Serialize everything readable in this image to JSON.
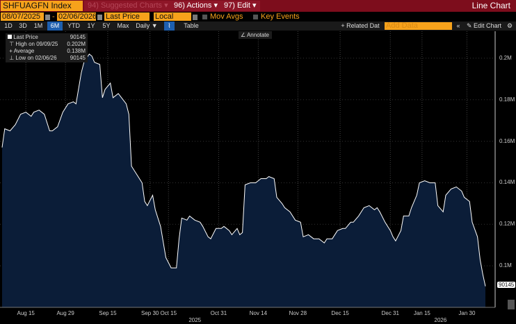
{
  "header": {
    "ticker": "SHFUAGFN Index",
    "menus": [
      {
        "label": "94) Suggested Charts ▾",
        "dim": true
      },
      {
        "label": "96) Actions ▾"
      },
      {
        "label": "97) Edit ▾"
      }
    ],
    "view": "Line Chart"
  },
  "controls": {
    "start_date": "08/07/2025",
    "end_date": "02/06/2026",
    "field": "Last Price",
    "currency": "Local CCY",
    "mov_avgs": "Mov Avgs",
    "key_events": "Key Events"
  },
  "toolbar": {
    "ranges": [
      "1D",
      "3D",
      "1M",
      "6M",
      "YTD",
      "1Y",
      "5Y",
      "Max"
    ],
    "active_range": "6M",
    "frequency": "Daily ▼",
    "table": "Table",
    "related": "+ Related Dat",
    "add_data_placeholder": "Add Data",
    "edit_chart": "Edit Chart",
    "annotate": "Annotate"
  },
  "legend": {
    "rows": [
      {
        "label": "Last Price",
        "value": "90145"
      },
      {
        "label": "High on 09/09/25",
        "value": "0.202M"
      },
      {
        "label": "Average",
        "value": "0.138M"
      },
      {
        "label": "Low on 02/06/26",
        "value": "90145"
      }
    ]
  },
  "colors": {
    "bar": "#7d0d1c",
    "accent": "#f7a21b",
    "fill": "#0b1d38",
    "line": "#ffffff"
  },
  "chart_data": {
    "type": "area",
    "title": "SHFUAGFN Index",
    "units": "thousands",
    "ylim": [
      80,
      213
    ],
    "xlim": [
      0,
      186
    ],
    "y_ticks": [
      {
        "v": 100,
        "label": "0.1M"
      },
      {
        "v": 120,
        "label": "0.12M"
      },
      {
        "v": 140,
        "label": "0.14M"
      },
      {
        "v": 160,
        "label": "0.16M"
      },
      {
        "v": 180,
        "label": "0.18M"
      },
      {
        "v": 200,
        "label": "0.2M"
      }
    ],
    "x_ticks": [
      {
        "d": 9,
        "label": "Aug 15"
      },
      {
        "d": 24,
        "label": "Aug 29"
      },
      {
        "d": 40,
        "label": "Sep 15"
      },
      {
        "d": 56,
        "label": "Sep 30"
      },
      {
        "d": 63,
        "label": "Oct 15"
      },
      {
        "d": 82,
        "label": "Oct 31"
      },
      {
        "d": 97,
        "label": "Nov 14"
      },
      {
        "d": 112,
        "label": "Nov 28"
      },
      {
        "d": 128,
        "label": "Dec 15"
      },
      {
        "d": 147,
        "label": "Dec 31"
      },
      {
        "d": 159,
        "label": "Jan 15"
      },
      {
        "d": 176,
        "label": "Jan 30"
      }
    ],
    "years": [
      {
        "d": 73,
        "label": "2025"
      },
      {
        "d": 166,
        "label": "2026"
      }
    ],
    "last_label": "90145",
    "points": [
      [
        0,
        157
      ],
      [
        1,
        166
      ],
      [
        3,
        165
      ],
      [
        5,
        168
      ],
      [
        7,
        173
      ],
      [
        9,
        174
      ],
      [
        11,
        172
      ],
      [
        12,
        174
      ],
      [
        14,
        175
      ],
      [
        16,
        173
      ],
      [
        18,
        165
      ],
      [
        19,
        165
      ],
      [
        21,
        167
      ],
      [
        23,
        174
      ],
      [
        25,
        178
      ],
      [
        27,
        179
      ],
      [
        28,
        178
      ],
      [
        30,
        193
      ],
      [
        31,
        198
      ],
      [
        33,
        202
      ],
      [
        34,
        201
      ],
      [
        35,
        198
      ],
      [
        37,
        197
      ],
      [
        38,
        181
      ],
      [
        39,
        185
      ],
      [
        41,
        188
      ],
      [
        42,
        181
      ],
      [
        44,
        183
      ],
      [
        47,
        178
      ],
      [
        48,
        173
      ],
      [
        49,
        148
      ],
      [
        51,
        144
      ],
      [
        53,
        140
      ],
      [
        54,
        131
      ],
      [
        55,
        129
      ],
      [
        57,
        134
      ],
      [
        58,
        127
      ],
      [
        60,
        119
      ],
      [
        62,
        104
      ],
      [
        64,
        99
      ],
      [
        66,
        99
      ],
      [
        67,
        113
      ],
      [
        68,
        123
      ],
      [
        70,
        122
      ],
      [
        71,
        124
      ],
      [
        73,
        122
      ],
      [
        75,
        121
      ],
      [
        76,
        119
      ],
      [
        78,
        114
      ],
      [
        79,
        113
      ],
      [
        81,
        118
      ],
      [
        83,
        118
      ],
      [
        84,
        119
      ],
      [
        86,
        117
      ],
      [
        87,
        115
      ],
      [
        89,
        118
      ],
      [
        90,
        115
      ],
      [
        91,
        116
      ],
      [
        92,
        139
      ],
      [
        94,
        140
      ],
      [
        96,
        140
      ],
      [
        98,
        142
      ],
      [
        100,
        142
      ],
      [
        101,
        143
      ],
      [
        103,
        142
      ],
      [
        104,
        133
      ],
      [
        106,
        130
      ],
      [
        107,
        128
      ],
      [
        109,
        126
      ],
      [
        111,
        122
      ],
      [
        113,
        121
      ],
      [
        114,
        114
      ],
      [
        116,
        115
      ],
      [
        118,
        113
      ],
      [
        120,
        113
      ],
      [
        122,
        111
      ],
      [
        123,
        113
      ],
      [
        125,
        113
      ],
      [
        127,
        117
      ],
      [
        129,
        118
      ],
      [
        130,
        118
      ],
      [
        132,
        121
      ],
      [
        133,
        121
      ],
      [
        135,
        124
      ],
      [
        137,
        128
      ],
      [
        139,
        129
      ],
      [
        141,
        127
      ],
      [
        142,
        128
      ],
      [
        143,
        126
      ],
      [
        145,
        121
      ],
      [
        147,
        117
      ],
      [
        148,
        114
      ],
      [
        149,
        112
      ],
      [
        151,
        117
      ],
      [
        152,
        124
      ],
      [
        154,
        124
      ],
      [
        155,
        128
      ],
      [
        157,
        134
      ],
      [
        158,
        140
      ],
      [
        160,
        141
      ],
      [
        162,
        140
      ],
      [
        164,
        140
      ],
      [
        165,
        129
      ],
      [
        167,
        126
      ],
      [
        168,
        134
      ],
      [
        170,
        137
      ],
      [
        172,
        138
      ],
      [
        174,
        136
      ],
      [
        175,
        133
      ],
      [
        177,
        131
      ],
      [
        178,
        121
      ],
      [
        180,
        114
      ],
      [
        181,
        103
      ],
      [
        182,
        96
      ],
      [
        183,
        90.145
      ]
    ]
  }
}
